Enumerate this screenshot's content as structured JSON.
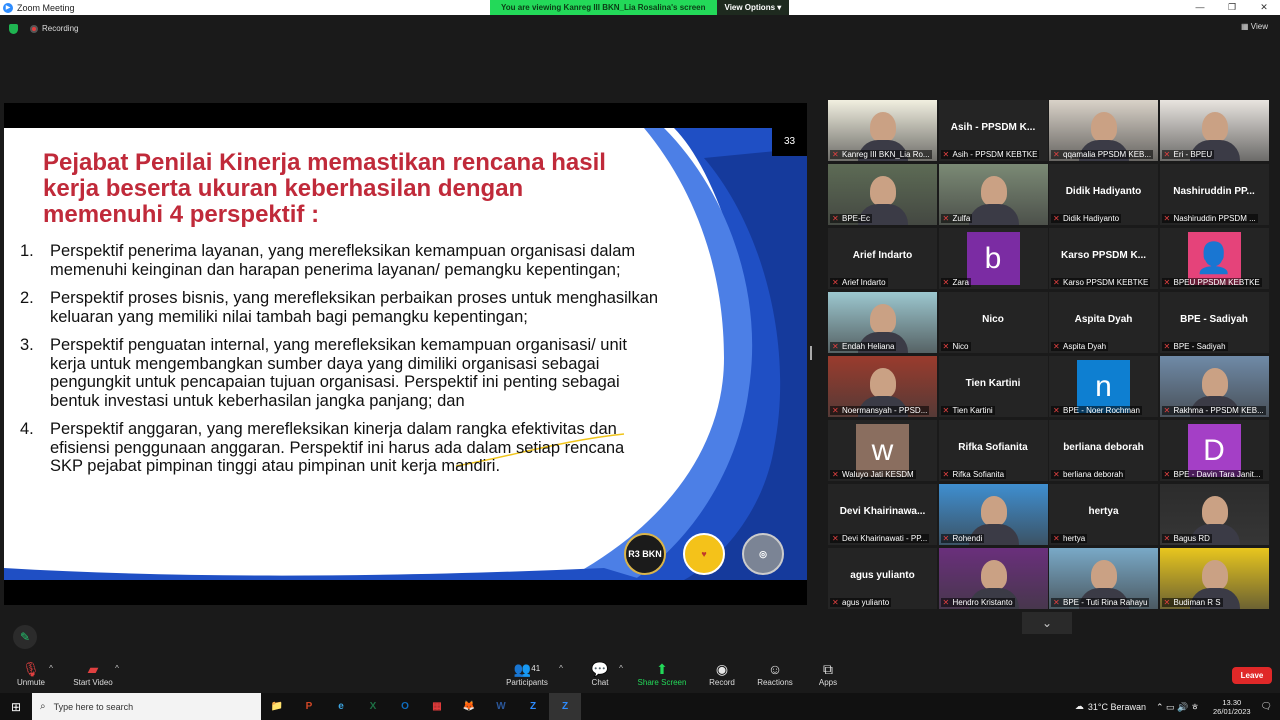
{
  "window": {
    "title": "Zoom Meeting",
    "min": "—",
    "restore": "❐",
    "close": "✕"
  },
  "share_banner": {
    "message": "You are viewing Kanreg III BKN_Lia Rosalina's screen",
    "options_label": "View Options",
    "options_caret": "▾"
  },
  "status": {
    "recording": "Recording",
    "view_label": "View"
  },
  "slide": {
    "number": "33",
    "title": "Pejabat Penilai Kinerja memastikan rencana hasil  kerja beserta ukuran keberhasilan dengan memenuhi 4 perspektif :",
    "items": [
      {
        "num": "1.",
        "text": "Perspektif penerima layanan, yang merefleksikan kemampuan organisasi dalam memenuhi keinginan dan harapan penerima layanan/ pemangku kepentingan;"
      },
      {
        "num": "2.",
        "text": "Perspektif proses bisnis, yang merefleksikan perbaikan proses untuk menghasilkan keluaran yang memiliki nilai tambah bagi pemangku kepentingan;"
      },
      {
        "num": "3.",
        "text": "Perspektif penguatan internal, yang merefleksikan kemampuan organisasi/ unit kerja untuk mengembangkan sumber daya yang dimiliki organisasi sebagai pengungkit untuk pencapaian tujuan organisasi. Perspektif ini penting sebagai bentuk investasi untuk keberhasilan jangka panjang; dan"
      },
      {
        "num": "4.",
        "text": "Perspektif anggaran, yang merefleksikan kinerja dalam rangka efektivitas dan efisiensi penggunaan anggaran. Perspektif ini harus ada dalam setiap rencana SKP pejabat pimpinan tinggi atau pimpinan unit kerja mandiri."
      }
    ],
    "logos": [
      "R3 BKN",
      "♥",
      "◎"
    ]
  },
  "participants": [
    {
      "label": "Kanreg III BKN_Lia Ro...",
      "name": "",
      "kind": "video",
      "color": "#f1efe0",
      "active": true
    },
    {
      "label": "Asih - PPSDM KEBTKE",
      "name": "Asih - PPSDM K...",
      "kind": "name"
    },
    {
      "label": "qqamalia PPSDM KEB...",
      "name": "",
      "kind": "video",
      "color": "#d9d2c8"
    },
    {
      "label": "Eri - BPEU",
      "name": "",
      "kind": "video",
      "color": "#e8e4df"
    },
    {
      "label": "BPE-Ec",
      "name": "",
      "kind": "video",
      "color": "#5d6b55"
    },
    {
      "label": "Zulfa",
      "name": "",
      "kind": "video",
      "color": "#7b8a75"
    },
    {
      "label": "Didik Hadiyanto",
      "name": "Didik Hadiyanto",
      "kind": "name"
    },
    {
      "label": "Nashiruddin PPSDM ...",
      "name": "Nashiruddin  PP...",
      "kind": "name"
    },
    {
      "label": "Arief Indarto",
      "name": "Arief Indarto",
      "kind": "name"
    },
    {
      "label": "Zara",
      "name": "b",
      "kind": "avatar",
      "color": "#7b2ca3"
    },
    {
      "label": "Karso PPSDM KEBTKE",
      "name": "Karso  PPSDM  K...",
      "kind": "name"
    },
    {
      "label": "BPEU PPSDM KEBTKE",
      "name": "👤",
      "kind": "avatar",
      "color": "#e5437a"
    },
    {
      "label": "Endah Heliana",
      "name": "",
      "kind": "video",
      "color": "#9cc7cf"
    },
    {
      "label": "Nico",
      "name": "Nico",
      "kind": "name"
    },
    {
      "label": "Aspita Dyah",
      "name": "Aspita Dyah",
      "kind": "name"
    },
    {
      "label": "BPE - Sadiyah",
      "name": "BPE - Sadiyah",
      "kind": "name"
    },
    {
      "label": "Noermansyah - PPSD...",
      "name": "",
      "kind": "video",
      "color": "#9a3b2d"
    },
    {
      "label": "Tien Kartini",
      "name": "Tien Kartini",
      "kind": "name"
    },
    {
      "label": "BPE - Noer Rochman",
      "name": "n",
      "kind": "avatar",
      "color": "#0e7fd1"
    },
    {
      "label": "Rakhma - PPSDM KEB...",
      "name": "",
      "kind": "video",
      "color": "#6f8aa7"
    },
    {
      "label": "Waluyo Jati KESDM",
      "name": "w",
      "kind": "avatar",
      "color": "#8a6e5f"
    },
    {
      "label": "Rifka Sofianita",
      "name": "Rifka Sofianita",
      "kind": "name"
    },
    {
      "label": "berliana deborah",
      "name": "berliana deborah",
      "kind": "name"
    },
    {
      "label": "BPE - Davin Tara Janit...",
      "name": "D",
      "kind": "avatar",
      "color": "#a43fc6"
    },
    {
      "label": "Devi Khairinawati - PP...",
      "name": "Devi  Khairinawa...",
      "kind": "name"
    },
    {
      "label": "Rohendi",
      "name": "",
      "kind": "video",
      "color": "#3f8fd0"
    },
    {
      "label": "hertya",
      "name": "hertya",
      "kind": "name"
    },
    {
      "label": "Bagus RD",
      "name": "",
      "kind": "video",
      "color": "#2c2c2c"
    },
    {
      "label": "agus yulianto",
      "name": "agus yulianto",
      "kind": "name"
    },
    {
      "label": "Hendro Kristanto",
      "name": "",
      "kind": "video",
      "color": "#6a2f7c"
    },
    {
      "label": "BPE - Tuti Rina Rahayu",
      "name": "",
      "kind": "video",
      "color": "#79a9c7"
    },
    {
      "label": "Budiman R S",
      "name": "",
      "kind": "video",
      "color": "#e8c61e"
    }
  ],
  "toolbar": {
    "unmute": "Unmute",
    "start_video": "Start Video",
    "participants": "Participants",
    "participants_count": "41",
    "chat": "Chat",
    "share_screen": "Share Screen",
    "record": "Record",
    "reactions": "Reactions",
    "apps": "Apps",
    "leave": "Leave",
    "caret": "^"
  },
  "taskbar": {
    "search_placeholder": "Type here to search",
    "weather": "31°C  Berawan",
    "time": "13.30",
    "date": "26/01/2023",
    "apps": [
      "📁",
      "P",
      "e",
      "X",
      "O",
      "▦",
      "🦊",
      "W",
      "Z",
      "Z"
    ]
  },
  "colors": {
    "accent_green": "#23d959",
    "leave_red": "#e02828",
    "slide_title": "#c02a3a",
    "slide_blue": "#1f4fc4"
  }
}
